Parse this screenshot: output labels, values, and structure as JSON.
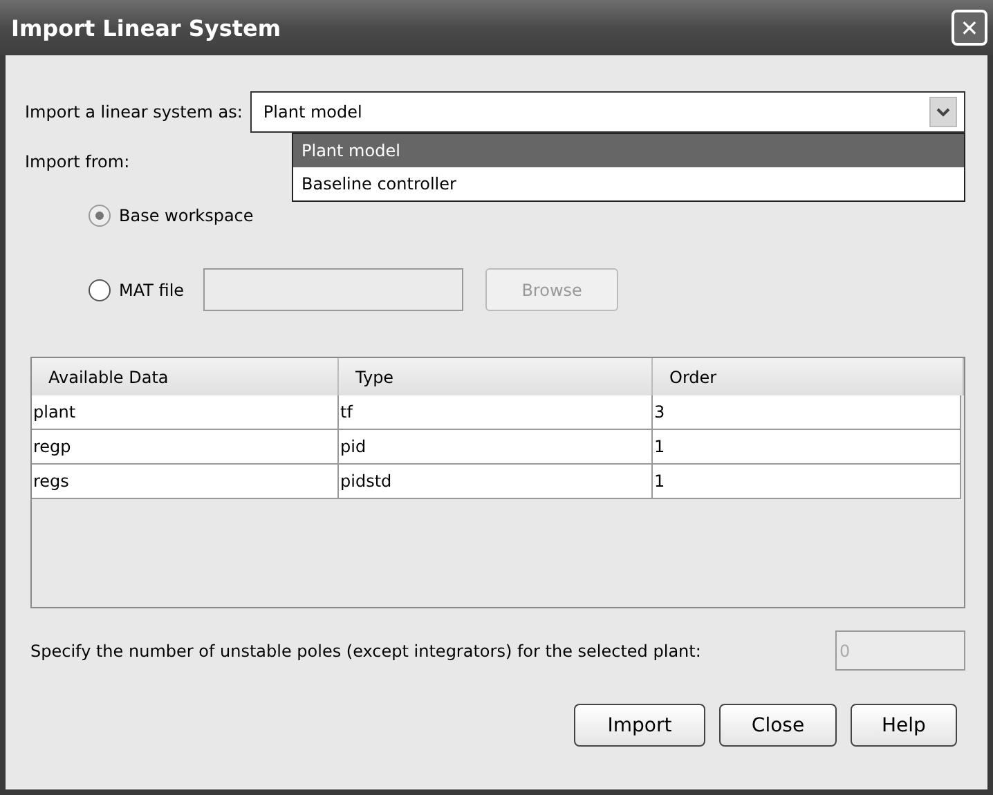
{
  "window": {
    "title": "Import Linear System",
    "close": "✕"
  },
  "import_as": {
    "label": "Import a linear system as:",
    "value": "Plant model",
    "expanded": true,
    "options": [
      {
        "label": "Plant model",
        "selected": true
      },
      {
        "label": "Baseline controller",
        "selected": false
      }
    ]
  },
  "import_from": {
    "label": "Import from:",
    "sources": [
      {
        "label": "Base workspace",
        "selected": true
      },
      {
        "label": "MAT file",
        "selected": false
      }
    ],
    "mat_file_field": {
      "disabled": true
    },
    "browse": {
      "label": "Browse",
      "disabled": true
    }
  },
  "table": {
    "columns": [
      "Available Data",
      "Type",
      "Order"
    ],
    "rows": [
      [
        "plant",
        "tf",
        "3"
      ],
      [
        "regp",
        "pid",
        "1"
      ],
      [
        "regs",
        "pidstd",
        "1"
      ]
    ]
  },
  "unstable_poles": {
    "label": "Specify the number of unstable poles (except integrators) for the selected plant:",
    "value": "0",
    "disabled": true
  },
  "buttons": [
    "Import",
    "Close",
    "Help"
  ]
}
